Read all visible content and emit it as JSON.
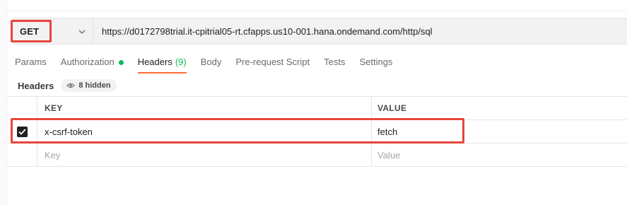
{
  "request": {
    "method": "GET",
    "url": "https://d0172798trial.it-cpitrial05-rt.cfapps.us10-001.hana.ondemand.com/http/sql"
  },
  "tabs": [
    {
      "label": "Params"
    },
    {
      "label": "Authorization"
    },
    {
      "label": "Headers",
      "count": "(9)"
    },
    {
      "label": "Body"
    },
    {
      "label": "Pre-request Script"
    },
    {
      "label": "Tests"
    },
    {
      "label": "Settings"
    }
  ],
  "headers_section": {
    "title": "Headers",
    "hidden_label": "8 hidden"
  },
  "table": {
    "key_header": "KEY",
    "value_header": "VALUE",
    "rows": [
      {
        "checked": true,
        "key": "x-csrf-token",
        "value": "fetch"
      }
    ],
    "new_row": {
      "key_placeholder": "Key",
      "value_placeholder": "Value"
    }
  },
  "colors": {
    "highlight": "#e8453c",
    "active_tab_underline": "#ff6c37",
    "status_green": "#0cbb52"
  }
}
